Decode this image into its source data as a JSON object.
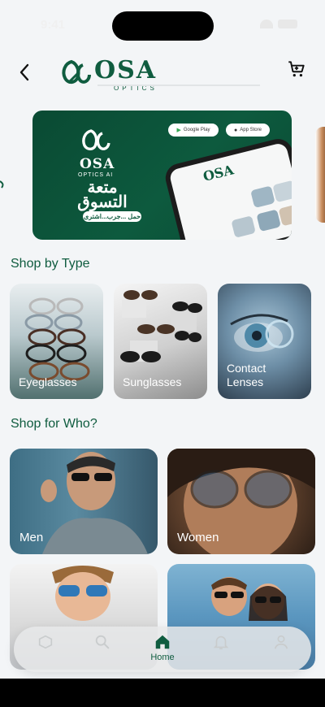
{
  "status": {
    "time": "9:41"
  },
  "header": {
    "brand": "OSA",
    "brand_sub": "OPTICS"
  },
  "banner": {
    "brand": "OSA",
    "brand_sub": "OPTICS AI",
    "arabic_title": "متعة التسوق",
    "arabic_tag": "حمل ...جرب...اشترى",
    "google_play": "Google Play",
    "app_store": "App Store",
    "phone_brand": "OSA"
  },
  "shop_by_type": {
    "title": "Shop by Type",
    "items": [
      {
        "label": "Eyeglasses"
      },
      {
        "label": "Sunglasses"
      },
      {
        "label": "Contact Lenses"
      }
    ]
  },
  "shop_for_who": {
    "title": "Shop for Who?",
    "items": [
      {
        "label": "Men"
      },
      {
        "label": "Women"
      },
      {
        "label": ""
      },
      {
        "label": ""
      }
    ]
  },
  "nav": {
    "active": "Home",
    "items": [
      {
        "icon": "box-icon",
        "label": ""
      },
      {
        "icon": "search-icon",
        "label": ""
      },
      {
        "icon": "home-icon",
        "label": "Home"
      },
      {
        "icon": "bell-icon",
        "label": ""
      },
      {
        "icon": "person-icon",
        "label": ""
      }
    ]
  },
  "colors": {
    "brand_green": "#0f5c3f",
    "background": "#f3f5f7"
  }
}
